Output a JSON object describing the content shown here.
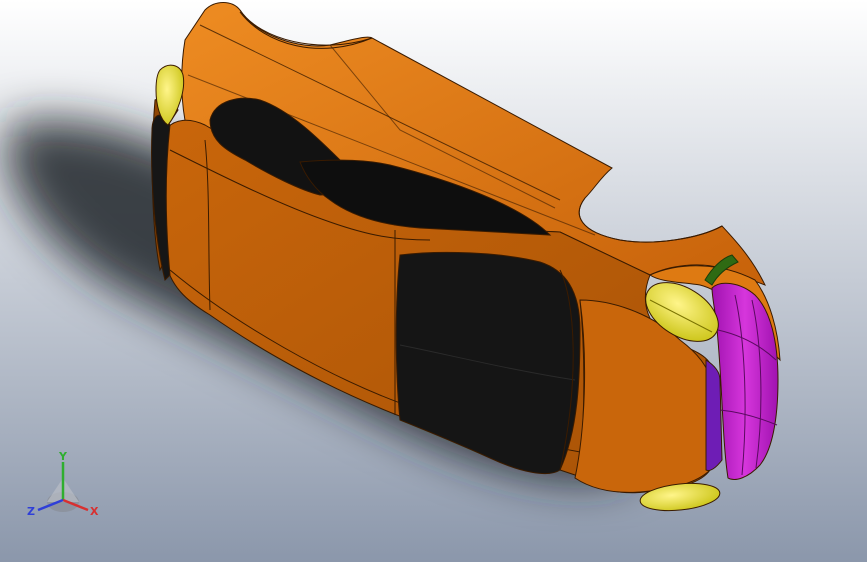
{
  "viewport": {
    "background_top": "#ffffff",
    "background_bottom": "#8b97ab"
  },
  "model": {
    "colors": {
      "body": "#d26a06",
      "body_light": "#ec8a1e",
      "body_dark": "#8f4503",
      "glass": "#121212",
      "headlight": "#d8d31c",
      "grille": "#c81ccf",
      "grille_inner": "#6e1db5",
      "trim": "#2f6a13",
      "edge": "#3a1b00"
    }
  },
  "triad": {
    "y_label": "Y",
    "x_label": "X",
    "z_label": "Z",
    "y_color": "#2fae2f",
    "x_color": "#d83030",
    "z_color": "#2f3fd8"
  }
}
